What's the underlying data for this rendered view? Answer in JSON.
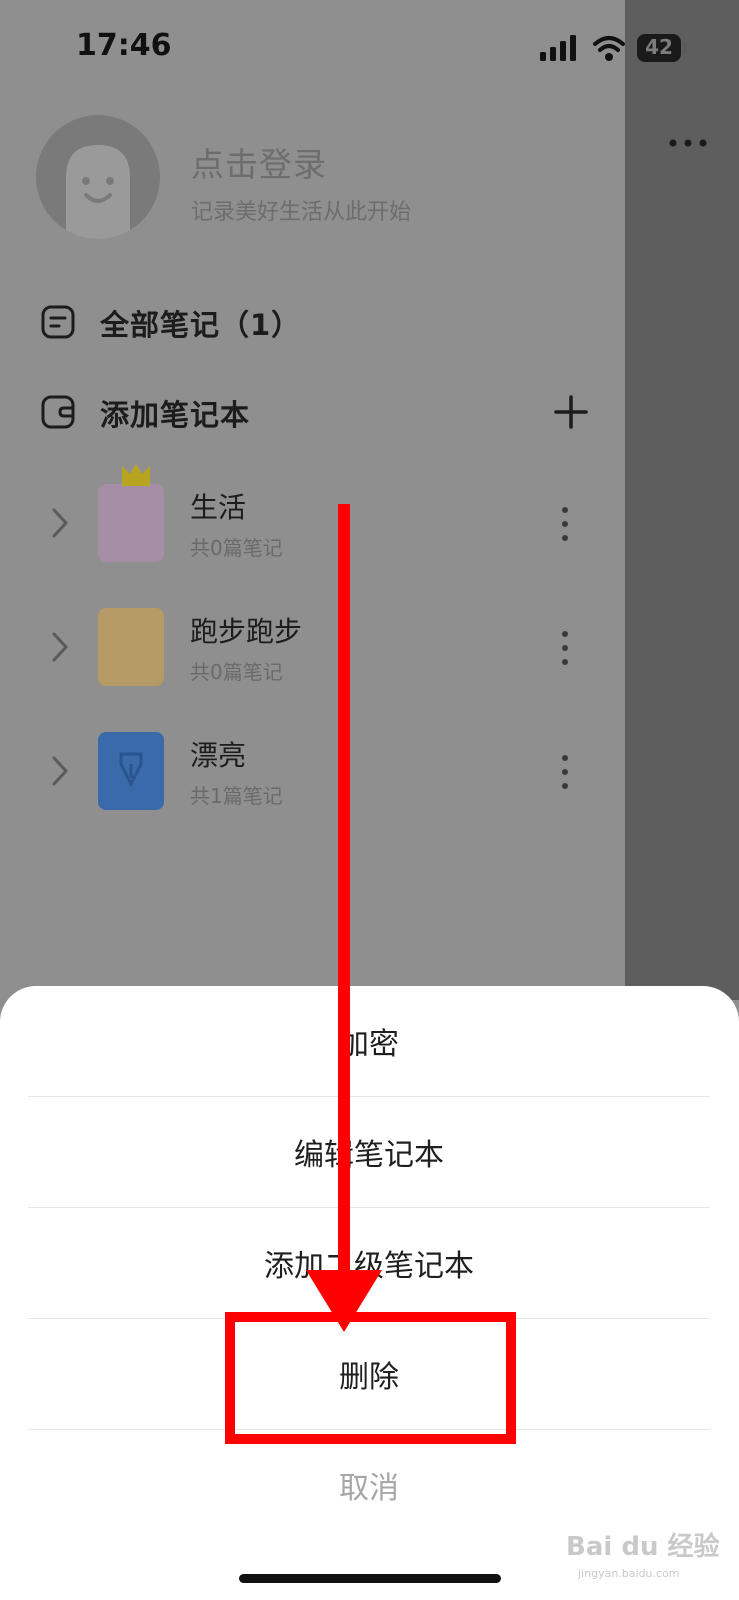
{
  "status_bar": {
    "time": "17:46",
    "battery": "42"
  },
  "profile": {
    "title": "点击登录",
    "subtitle": "记录美好生活从此开始"
  },
  "menu": {
    "all_notes": "全部笔记（1）",
    "add_notebook": "添加笔记本"
  },
  "notebooks": [
    {
      "name": "生活",
      "count": "共0篇笔记",
      "cover_color": "#a58ea6"
    },
    {
      "name": "跑步跑步",
      "count": "共0篇笔记",
      "cover_color": "#b59a66"
    },
    {
      "name": "漂亮",
      "count": "共1篇笔记",
      "cover_color": "#3b6aaa"
    }
  ],
  "action_sheet": {
    "encrypt": "加密",
    "edit_notebook": "编辑笔记本",
    "add_sub_notebook": "添加二级笔记本",
    "delete": "删除",
    "cancel": "取消"
  },
  "watermark": {
    "text": "Bai du 经验",
    "sub": "jingyan.baidu.com"
  },
  "colors": {
    "annotation": "#ff0000",
    "overlay": "#8f8f8f"
  }
}
